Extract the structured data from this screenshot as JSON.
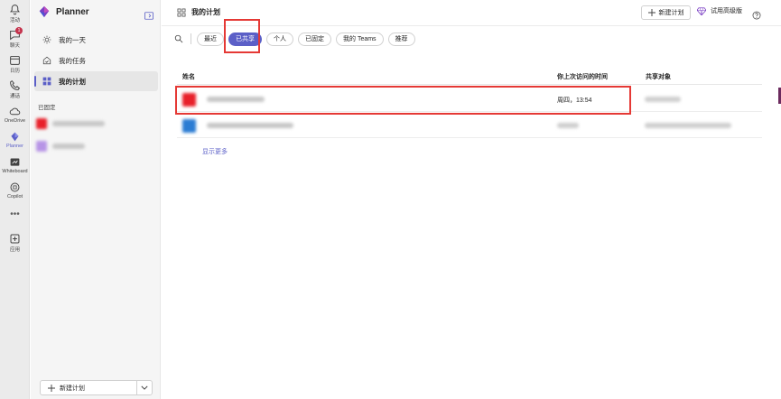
{
  "rail": {
    "items": [
      {
        "label": "活动",
        "icon": "bell-icon"
      },
      {
        "label": "聊天",
        "icon": "chat-icon",
        "badge": "1"
      },
      {
        "label": "日历",
        "icon": "calendar-icon"
      },
      {
        "label": "通话",
        "icon": "phone-icon"
      },
      {
        "label": "OneDrive",
        "icon": "cloud-icon"
      },
      {
        "label": "Planner",
        "icon": "planner-icon"
      },
      {
        "label": "Whiteboard",
        "icon": "whiteboard-icon"
      },
      {
        "label": "Copilot",
        "icon": "copilot-icon"
      },
      {
        "label": "应用",
        "icon": "add-app-icon"
      }
    ],
    "more": "•••"
  },
  "nav": {
    "app_name": "Planner",
    "items": [
      {
        "label": "我的一天",
        "icon": "sun-icon"
      },
      {
        "label": "我的任务",
        "icon": "home-task-icon"
      },
      {
        "label": "我的计划",
        "icon": "grid-icon"
      }
    ],
    "pinned_header": "已固定",
    "new_plan_label": "新建计划"
  },
  "topbar": {
    "title": "我的计划",
    "new_plan_button": "新建计划",
    "premium_button": "试用高级版"
  },
  "filters": [
    "最近",
    "已共享",
    "个人",
    "已固定",
    "我的 Teams",
    "推荐"
  ],
  "selected_filter": "已共享",
  "table": {
    "columns": {
      "name": "姓名",
      "last_visited": "你上次访问的时间",
      "shared_with": "共享对象"
    },
    "rows": [
      {
        "last_visited": "周四，13:54",
        "icon_color": "#e8202a"
      },
      {
        "last_visited": "",
        "icon_color": "#2b7cd3"
      }
    ],
    "show_more": "显示更多"
  },
  "colors": {
    "accent": "#5b5fc7",
    "highlight": "#e53935"
  }
}
